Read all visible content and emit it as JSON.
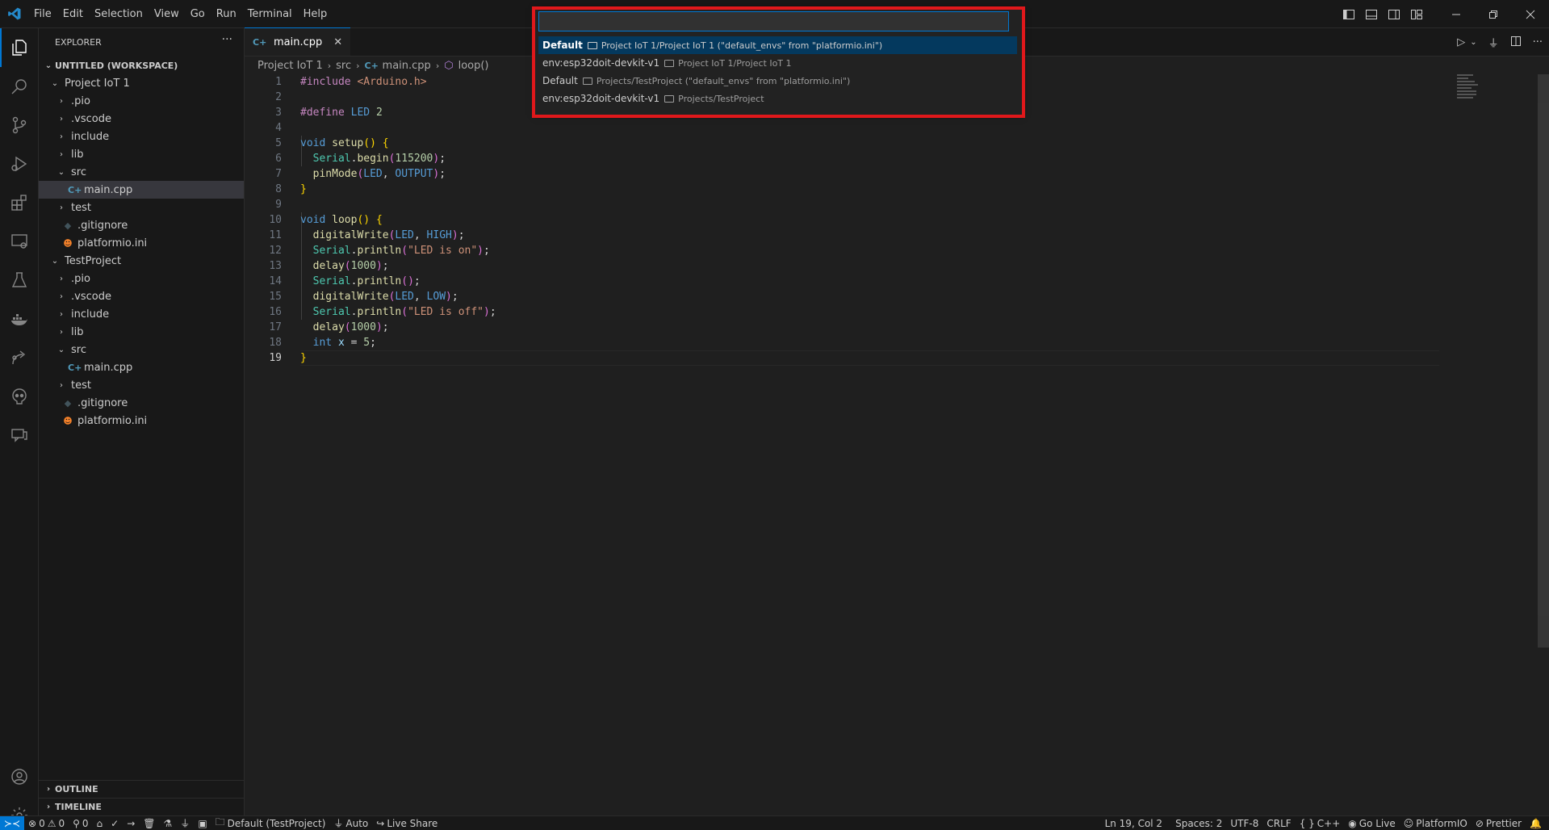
{
  "menu": [
    "File",
    "Edit",
    "Selection",
    "View",
    "Go",
    "Run",
    "Terminal",
    "Help"
  ],
  "sidebar": {
    "title": "EXPLORER",
    "more": "···",
    "workspace": "UNTITLED (WORKSPACE)",
    "tree": [
      {
        "label": "Project IoT 1",
        "type": "folder-open",
        "depth": 0
      },
      {
        "label": ".pio",
        "type": "folder",
        "depth": 1
      },
      {
        "label": ".vscode",
        "type": "folder",
        "depth": 1
      },
      {
        "label": "include",
        "type": "folder",
        "depth": 1
      },
      {
        "label": "lib",
        "type": "folder",
        "depth": 1
      },
      {
        "label": "src",
        "type": "folder-open",
        "depth": 1
      },
      {
        "label": "main.cpp",
        "type": "cpp",
        "depth": 2,
        "selected": true
      },
      {
        "label": "test",
        "type": "folder",
        "depth": 1
      },
      {
        "label": ".gitignore",
        "type": "git",
        "depth": 1
      },
      {
        "label": "platformio.ini",
        "type": "pio",
        "depth": 1
      },
      {
        "label": "TestProject",
        "type": "folder-open",
        "depth": 0
      },
      {
        "label": ".pio",
        "type": "folder",
        "depth": 1
      },
      {
        "label": ".vscode",
        "type": "folder",
        "depth": 1
      },
      {
        "label": "include",
        "type": "folder",
        "depth": 1
      },
      {
        "label": "lib",
        "type": "folder",
        "depth": 1
      },
      {
        "label": "src",
        "type": "folder-open",
        "depth": 1
      },
      {
        "label": "main.cpp",
        "type": "cpp",
        "depth": 2
      },
      {
        "label": "test",
        "type": "folder",
        "depth": 1
      },
      {
        "label": ".gitignore",
        "type": "git",
        "depth": 1
      },
      {
        "label": "platformio.ini",
        "type": "pio",
        "depth": 1
      }
    ],
    "outline": "OUTLINE",
    "timeline": "TIMELINE"
  },
  "editor": {
    "tab": "main.cpp",
    "breadcrumb": [
      "Project IoT 1",
      "src",
      "main.cpp",
      "loop()"
    ],
    "current_line": 19
  },
  "quickpick": {
    "input_value": "",
    "items": [
      {
        "label": "Default",
        "description": "Project IoT 1/Project IoT 1 (\"default_envs\" from \"platformio.ini\")",
        "focused": true
      },
      {
        "label": "env:esp32doit-devkit-v1",
        "description": "Project IoT 1/Project IoT 1"
      },
      {
        "label": "Default",
        "description": "Projects/TestProject (\"default_envs\" from \"platformio.ini\")"
      },
      {
        "label": "env:esp32doit-devkit-v1",
        "description": "Projects/TestProject"
      }
    ]
  },
  "statusbar": {
    "errors": "0",
    "warnings": "0",
    "ports": "0",
    "env": "Default (TestProject)",
    "auto": "Auto",
    "live_share": "Live Share",
    "position": "Ln 19, Col 2",
    "spaces": "Spaces: 2",
    "encoding": "UTF-8",
    "eol": "CRLF",
    "language": "C++",
    "go_live": "Go Live",
    "platformio": "PlatformIO",
    "prettier": "Prettier"
  }
}
